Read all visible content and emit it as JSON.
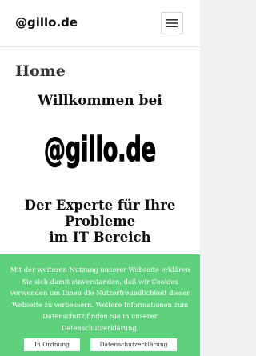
{
  "header": {
    "site_title": "@gillo.de",
    "menu_icon": "hamburger-icon"
  },
  "main": {
    "page_title": "Home",
    "welcome": "Willkommen bei",
    "logo_text": "@gillo.de",
    "tagline_lines": [
      "Der Experte für Ihre",
      "Probleme",
      "im IT Bereich"
    ]
  },
  "cookie_banner": {
    "text": "Mit der weiteren Nutzung unserer Webseite erklären Sie sich damit einverstanden, daß wir Cookies verwenden um Ihnen die Nutzerfreundlichkeit dieser Webseite zu verbessern. Weitere Informationen zum Datenschutz finden Sie in unserer Datenschutzerklärung.",
    "accept_label": "In Ordnung",
    "privacy_label": "Datenschutzerklärung"
  },
  "colors": {
    "banner": "#5fd07b",
    "logo": "#000000"
  }
}
